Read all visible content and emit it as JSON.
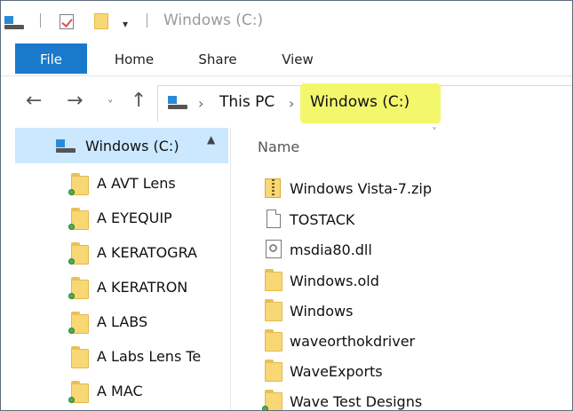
{
  "window": {
    "title": "Windows (C:)"
  },
  "ribbon": {
    "tabs": [
      "File",
      "Home",
      "Share",
      "View"
    ]
  },
  "address": {
    "crumbs": [
      "This PC",
      "Windows (C:)"
    ]
  },
  "nav_pane": {
    "root": "Windows (C:)",
    "items": [
      "A AVT Lens",
      "A EYEQUIP",
      "A KERATOGRA",
      "A KERATRON",
      "A LABS",
      "A Labs Lens Te",
      "A MAC"
    ]
  },
  "file_list": {
    "column_name": "Name",
    "files": [
      {
        "name": "Windows Vista-7.zip",
        "icon": "zip-icon"
      },
      {
        "name": "TOSTACK",
        "icon": "document-icon"
      },
      {
        "name": "msdia80.dll",
        "icon": "dll-icon"
      },
      {
        "name": "Windows.old",
        "icon": "folder-icon"
      },
      {
        "name": "Windows",
        "icon": "folder-icon"
      },
      {
        "name": "waveorthokdriver",
        "icon": "folder-icon"
      },
      {
        "name": "WaveExports",
        "icon": "folder-icon"
      },
      {
        "name": "Wave Test Designs",
        "icon": "folder-icon"
      }
    ]
  },
  "colors": {
    "file_tab": "#1979ca",
    "nav_selected": "#cce8ff",
    "highlight": "#f2f76c",
    "folder": "#f8d775"
  }
}
